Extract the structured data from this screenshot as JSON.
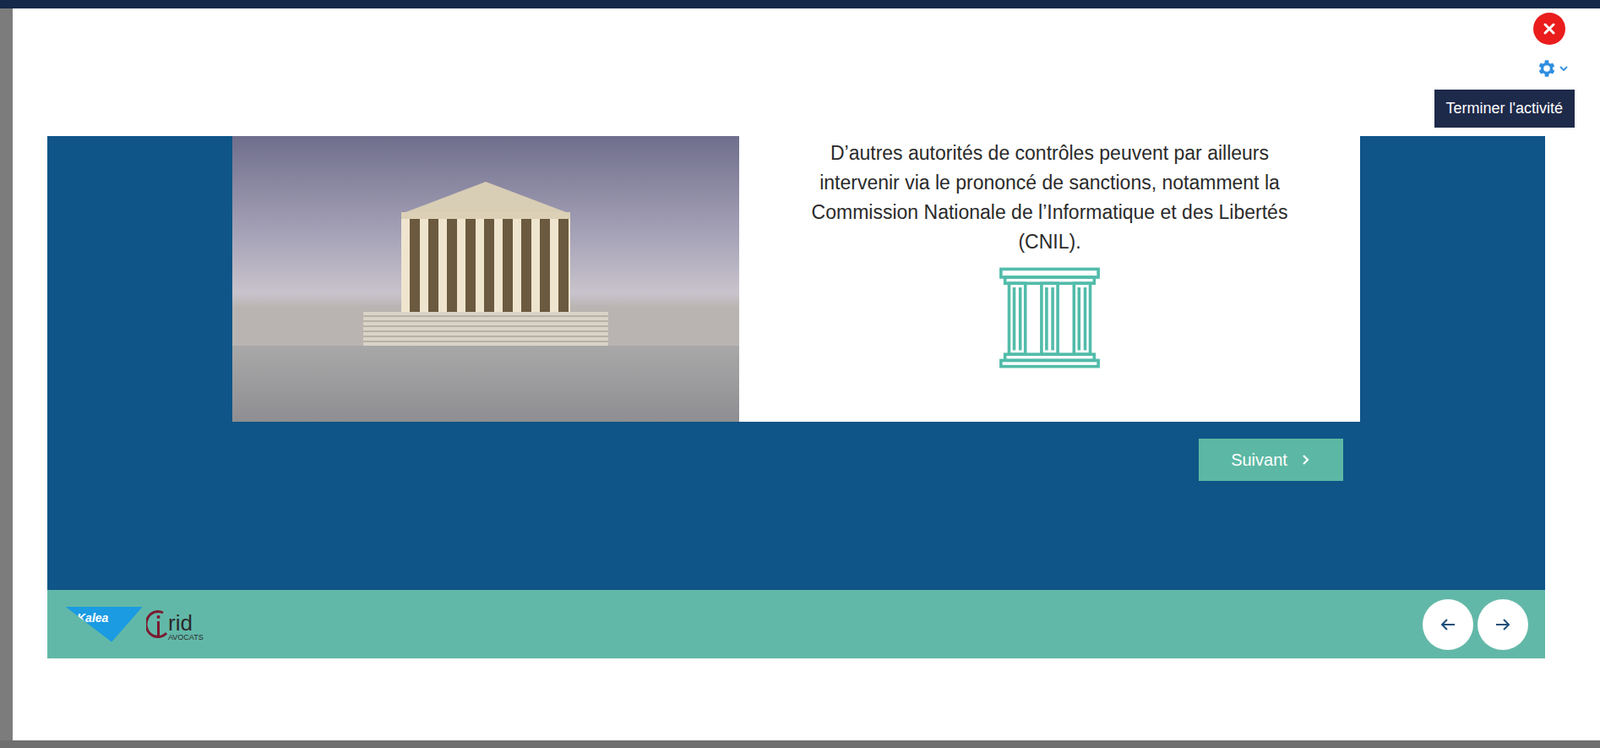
{
  "modal": {
    "tooltip": "Terminer l'activité"
  },
  "slide": {
    "text_lines": [
      "D’autres autorités de contrôles peuvent par ailleurs",
      "intervenir via le prononcé de sanctions, notamment la",
      "Commission Nationale de l’Informatique et des Libertés",
      "(CNIL)."
    ]
  },
  "buttons": {
    "next": "Suivant"
  },
  "footer": {
    "kalea_logo": "Kalea",
    "orid_logo": {
      "name": "rid",
      "sub": "AVOCATS"
    }
  }
}
